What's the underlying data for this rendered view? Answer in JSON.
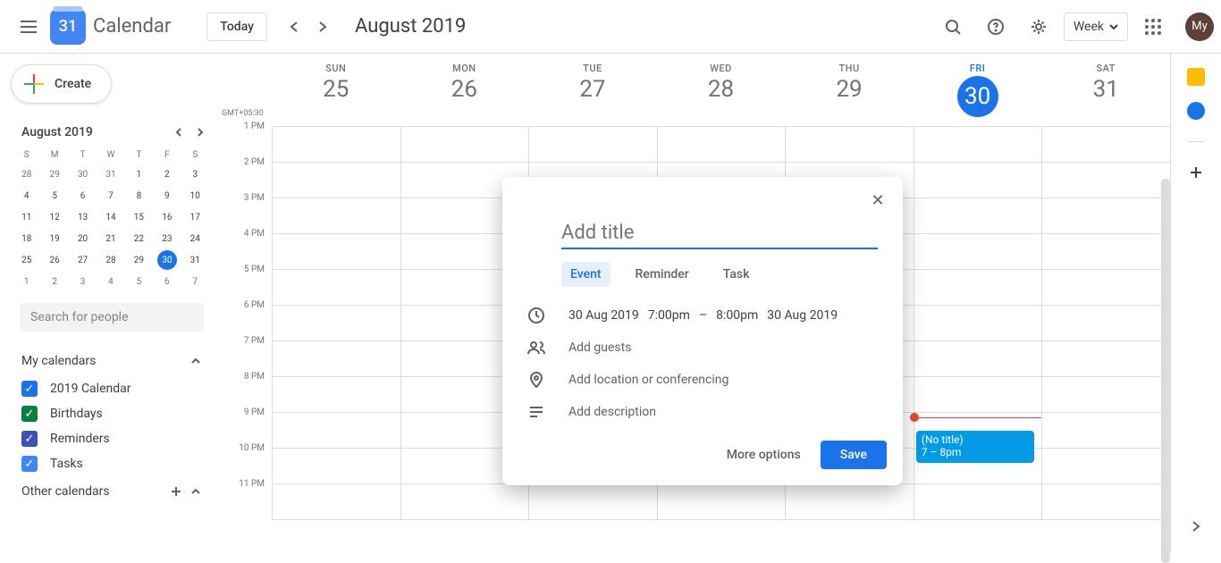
{
  "header": {
    "app_title": "Calendar",
    "logo_day": "31",
    "today_label": "Today",
    "month_title": "August 2019",
    "view_label": "Week",
    "avatar": "My"
  },
  "sidebar": {
    "create_label": "Create",
    "mini_title": "August 2019",
    "dow": [
      "S",
      "M",
      "T",
      "W",
      "T",
      "F",
      "S"
    ],
    "mini_days": [
      {
        "d": "28",
        "dim": true
      },
      {
        "d": "29",
        "dim": true
      },
      {
        "d": "30",
        "dim": true
      },
      {
        "d": "31",
        "dim": true
      },
      {
        "d": "1"
      },
      {
        "d": "2"
      },
      {
        "d": "3"
      },
      {
        "d": "4"
      },
      {
        "d": "5"
      },
      {
        "d": "6"
      },
      {
        "d": "7"
      },
      {
        "d": "8"
      },
      {
        "d": "9"
      },
      {
        "d": "10"
      },
      {
        "d": "11"
      },
      {
        "d": "12"
      },
      {
        "d": "13"
      },
      {
        "d": "14"
      },
      {
        "d": "15"
      },
      {
        "d": "16"
      },
      {
        "d": "17"
      },
      {
        "d": "18"
      },
      {
        "d": "19"
      },
      {
        "d": "20"
      },
      {
        "d": "21"
      },
      {
        "d": "22"
      },
      {
        "d": "23"
      },
      {
        "d": "24"
      },
      {
        "d": "25"
      },
      {
        "d": "26"
      },
      {
        "d": "27"
      },
      {
        "d": "28"
      },
      {
        "d": "29"
      },
      {
        "d": "30",
        "today": true
      },
      {
        "d": "31"
      },
      {
        "d": "1",
        "dim": true
      },
      {
        "d": "2",
        "dim": true
      },
      {
        "d": "3",
        "dim": true
      },
      {
        "d": "4",
        "dim": true
      },
      {
        "d": "5",
        "dim": true
      },
      {
        "d": "6",
        "dim": true
      },
      {
        "d": "7",
        "dim": true
      }
    ],
    "search_placeholder": "Search for people",
    "my_calendars_label": "My calendars",
    "other_calendars_label": "Other calendars",
    "calendars": [
      {
        "label": "2019 Calendar",
        "color": "#1a73e8"
      },
      {
        "label": "Birthdays",
        "color": "#0b8043"
      },
      {
        "label": "Reminders",
        "color": "#3f51b5"
      },
      {
        "label": "Tasks",
        "color": "#4285f4"
      }
    ]
  },
  "week": {
    "tz": "GMT+05:30",
    "days": [
      {
        "dow": "SUN",
        "num": "25"
      },
      {
        "dow": "MON",
        "num": "26"
      },
      {
        "dow": "TUE",
        "num": "27"
      },
      {
        "dow": "WED",
        "num": "28"
      },
      {
        "dow": "THU",
        "num": "29"
      },
      {
        "dow": "FRI",
        "num": "30",
        "today": true
      },
      {
        "dow": "SAT",
        "num": "31"
      }
    ],
    "hours": [
      "1 PM",
      "2 PM",
      "3 PM",
      "4 PM",
      "5 PM",
      "6 PM",
      "7 PM",
      "8 PM",
      "9 PM",
      "10 PM",
      "11 PM"
    ],
    "event": {
      "title": "(No title)",
      "time": "7 – 8pm"
    }
  },
  "modal": {
    "title_placeholder": "Add title",
    "tabs": {
      "event": "Event",
      "reminder": "Reminder",
      "task": "Task"
    },
    "date_start": "30 Aug 2019",
    "time_start": "7:00pm",
    "dash": "–",
    "time_end": "8:00pm",
    "date_end": "30 Aug 2019",
    "guests_placeholder": "Add guests",
    "location_placeholder": "Add location or conferencing",
    "description_placeholder": "Add description",
    "more_options": "More options",
    "save": "Save"
  }
}
